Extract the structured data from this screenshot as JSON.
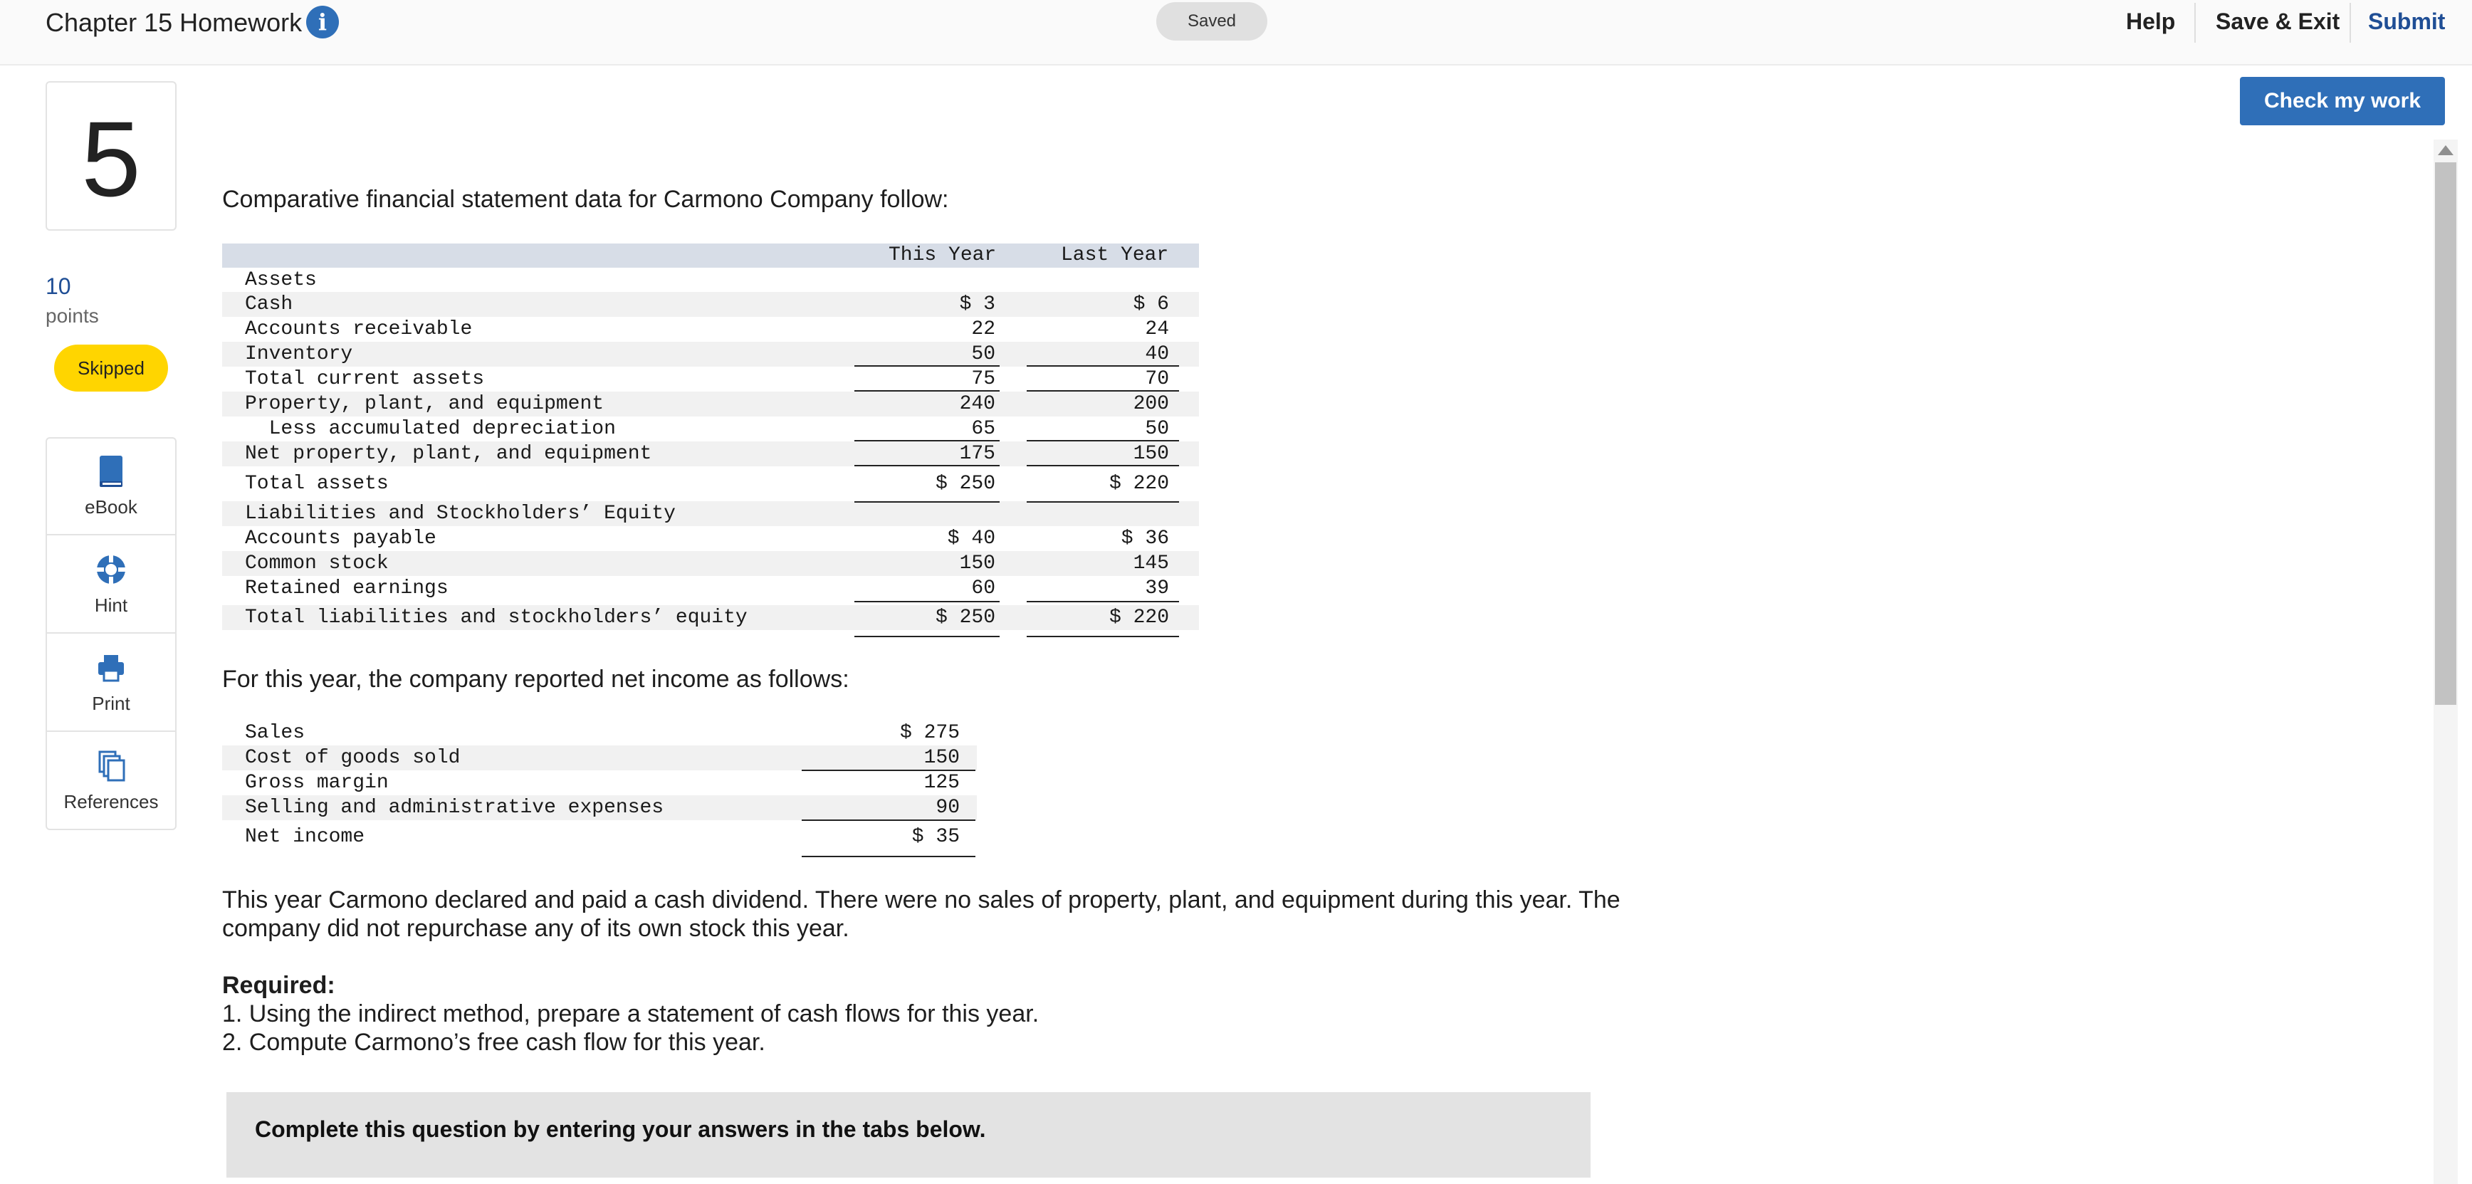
{
  "header": {
    "title": "Chapter 15 Homework",
    "info_icon": "i",
    "status": "Saved",
    "help_label": "Help",
    "save_exit_label": "Save & Exit",
    "submit_label": "Submit"
  },
  "question": {
    "number": "5",
    "points_value": "10",
    "points_label": "points",
    "status_badge": "Skipped"
  },
  "tools": [
    {
      "label": "eBook",
      "icon": "book-icon"
    },
    {
      "label": "Hint",
      "icon": "lifebuoy-icon"
    },
    {
      "label": "Print",
      "icon": "printer-icon"
    },
    {
      "label": "References",
      "icon": "documents-icon"
    }
  ],
  "check_button": "Check my work",
  "colors": {
    "accent": "#2f6fb8",
    "submit": "#1f4e95",
    "badge": "#ffd500"
  },
  "intro": "Comparative financial statement data for Carmono Company follow:",
  "balance_sheet": {
    "headers": [
      "This Year",
      "Last Year"
    ],
    "rows": [
      {
        "label": "Assets",
        "this": "",
        "last": ""
      },
      {
        "label": "Cash",
        "this": "$ 3",
        "last": "$ 6"
      },
      {
        "label": "Accounts receivable",
        "this": "22",
        "last": "24"
      },
      {
        "label": "Inventory",
        "this": "50",
        "last": "40"
      },
      {
        "label": "Total current assets",
        "this": "75",
        "last": "70"
      },
      {
        "label": "Property, plant, and equipment",
        "this": "240",
        "last": "200"
      },
      {
        "label": "  Less accumulated depreciation",
        "this": "65",
        "last": "50"
      },
      {
        "label": "Net property, plant, and equipment",
        "this": "175",
        "last": "150"
      },
      {
        "label": "Total assets",
        "this": "$ 250",
        "last": "$ 220"
      },
      {
        "label": "Liabilities and Stockholders’ Equity",
        "this": "",
        "last": ""
      },
      {
        "label": "Accounts payable",
        "this": "$ 40",
        "last": "$ 36"
      },
      {
        "label": "Common stock",
        "this": "150",
        "last": "145"
      },
      {
        "label": "Retained earnings",
        "this": "60",
        "last": "39"
      },
      {
        "label": "Total liabilities and stockholders’ equity",
        "this": "$ 250",
        "last": "$ 220"
      }
    ]
  },
  "income_intro": "For this year, the company reported net income as follows:",
  "income_statement": {
    "rows": [
      {
        "label": "Sales",
        "value": "$ 275"
      },
      {
        "label": "Cost of goods sold",
        "value": "150"
      },
      {
        "label": "Gross margin",
        "value": "125"
      },
      {
        "label": "Selling and administrative expenses",
        "value": "90"
      },
      {
        "label": "Net income",
        "value": "$ 35"
      }
    ]
  },
  "paragraph_line1": "This year Carmono declared and paid a cash dividend. There were no sales of property, plant, and equipment during this year. The",
  "paragraph_line2": "company did not repurchase any of its own stock this year.",
  "required_heading": "Required:",
  "required_items": [
    "1. Using the indirect method, prepare a statement of cash flows for this year.",
    "2. Compute Carmono’s free cash flow for this year."
  ],
  "tabs_banner": "Complete this question by entering your answers in the tabs below."
}
